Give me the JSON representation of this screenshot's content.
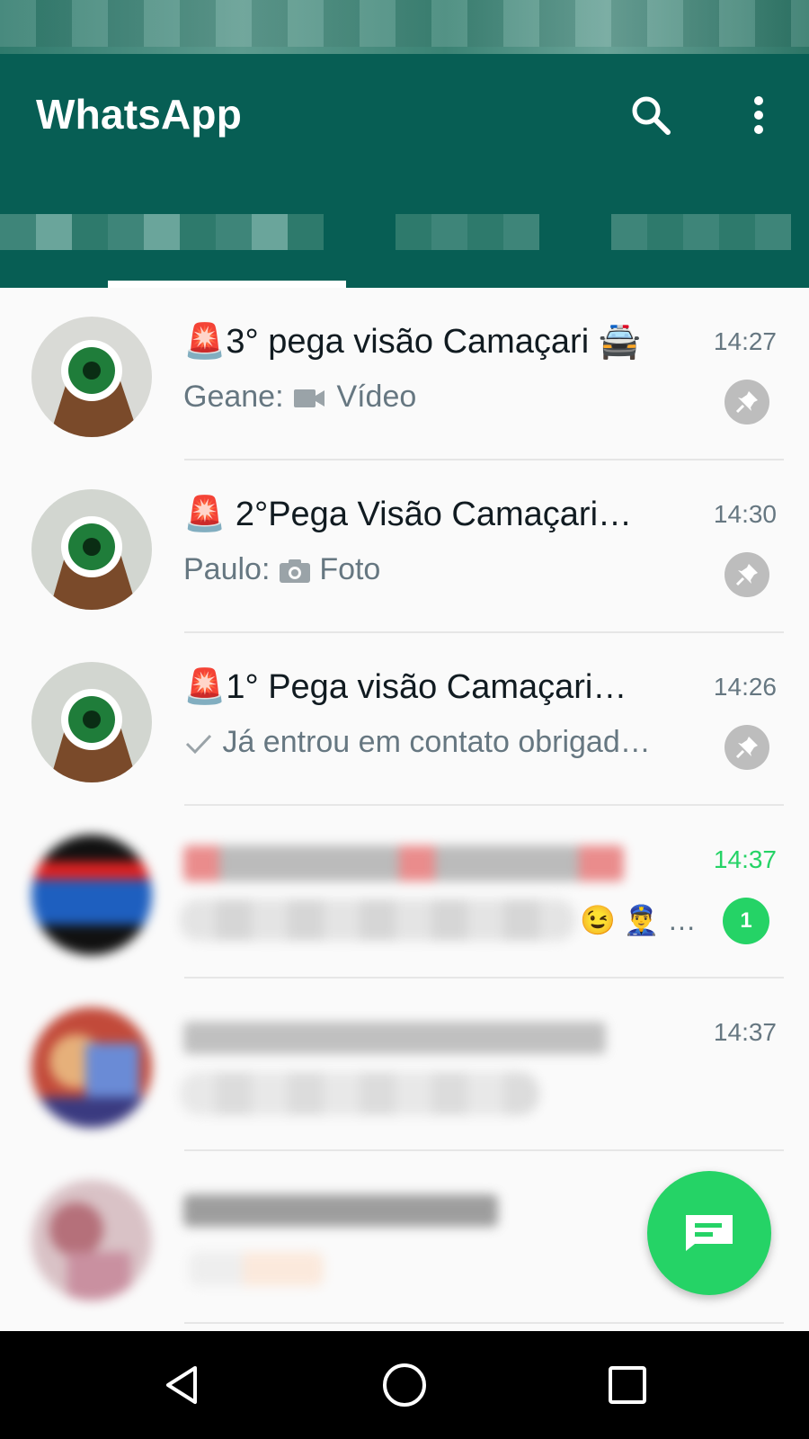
{
  "app": {
    "title": "WhatsApp"
  },
  "header": {
    "icons": [
      "search-icon",
      "more-vert-icon"
    ]
  },
  "colors": {
    "header": "#075e54",
    "accent": "#25d366",
    "muted": "#667781",
    "pin": "#bdbdbd"
  },
  "chats": [
    {
      "name": "🚨3° pega visão Camaçari 🚔",
      "time": "14:27",
      "sender": "Geane: ",
      "media_icon": "video-icon",
      "preview": "Vídeo",
      "pinned": true
    },
    {
      "name": "🚨 2°Pega Visão Camaçari…",
      "time": "14:30",
      "sender": "Paulo: ",
      "media_icon": "camera-icon",
      "preview": "Foto",
      "pinned": true
    },
    {
      "name": "🚨1° Pega visão Camaçari…",
      "time": "14:26",
      "sender": "",
      "media_icon": "check-icon",
      "preview": "Já entrou em contato obrigad…",
      "pinned": true
    },
    {
      "time": "14:37",
      "preview_emojis": "😉 👮‍♂️ …",
      "unread_count": "1"
    },
    {
      "time": "14:37"
    },
    {
      "time": ""
    }
  ],
  "nav": {
    "icons": [
      "back-icon",
      "home-icon",
      "recents-icon"
    ]
  },
  "fab": {
    "icon": "new-chat-icon"
  }
}
